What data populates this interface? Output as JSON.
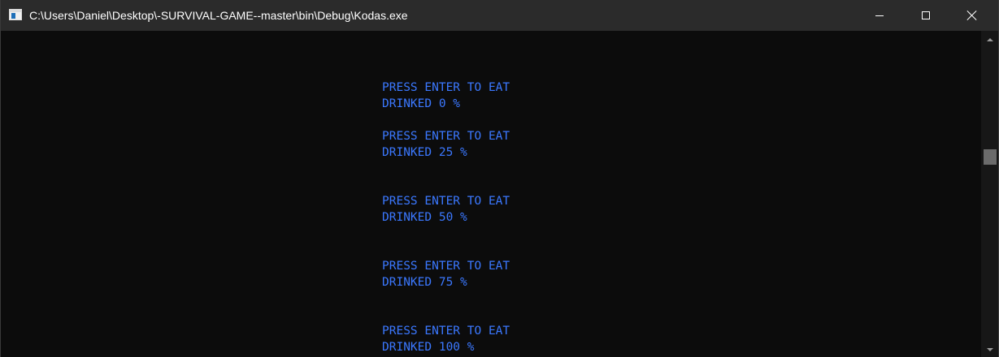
{
  "window": {
    "title": "C:\\Users\\Daniel\\Desktop\\-SURVIVAL-GAME--master\\bin\\Debug\\Kodas.exe",
    "icon": "console-app-icon",
    "controls": {
      "minimize_icon": "minimize-icon",
      "maximize_icon": "maximize-icon",
      "close_icon": "close-icon"
    }
  },
  "console": {
    "text_color": "#3b78ff",
    "background": "#0c0c0c",
    "lines": [
      "PRESS ENTER TO EAT",
      "DRINKED 0 %",
      "PRESS ENTER TO EAT",
      "DRINKED 25 %",
      "PRESS ENTER TO EAT",
      "DRINKED 50 %",
      "PRESS ENTER TO EAT",
      "DRINKED 75 %",
      "PRESS ENTER TO EAT",
      "DRINKED 100 %"
    ]
  },
  "scrollbar": {
    "up_icon": "scroll-up-arrow-icon",
    "down_icon": "scroll-down-arrow-icon"
  }
}
